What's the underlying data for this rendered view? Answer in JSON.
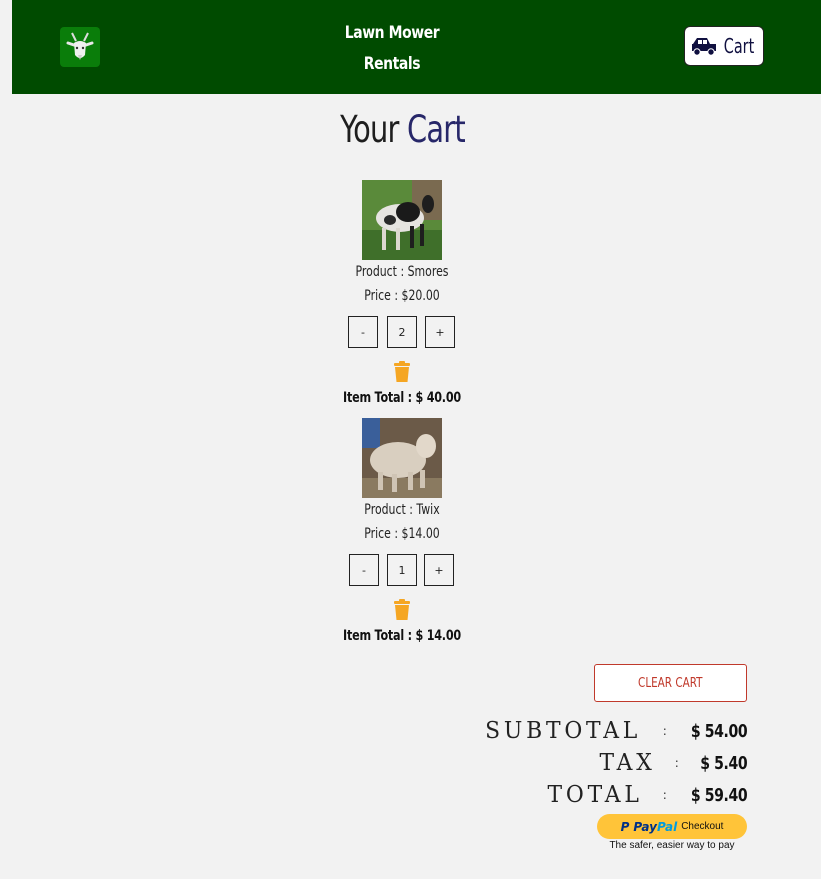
{
  "nav": {
    "brand_line1": "Lawn Mower",
    "brand_line2": "Rentals",
    "logo_icon": "goat-icon",
    "cart_label": "Cart",
    "cart_icon": "truck-icon"
  },
  "page": {
    "title_word1": "Your",
    "title_word2": "Cart"
  },
  "items": [
    {
      "product": "Product : Smores",
      "price": "Price : $20.00",
      "minus": "-",
      "qty": "2",
      "plus": "+",
      "item_total": "Item Total : $ 40.00"
    },
    {
      "product": "Product : Twix",
      "price": "Price : $14.00",
      "minus": "-",
      "qty": "1",
      "plus": "+",
      "item_total": "Item Total : $ 14.00"
    }
  ],
  "summary": {
    "clear_label": "CLEAR CART",
    "subtotal_label": "SUBTOTAL",
    "subtotal_value": "$ 54.00",
    "tax_label": "TAX",
    "tax_value": "$ 5.40",
    "total_label": "TOTAL",
    "total_value": "$ 59.40",
    "colon": ":"
  },
  "paypal": {
    "brand_a": "Pay",
    "brand_b": "Pal",
    "checkout": "Checkout",
    "tagline": "The safer, easier way to pay"
  },
  "colors": {
    "nav_bg": "#004b00",
    "accent": "#272769",
    "clear": "#c0392b",
    "paypal_yellow": "#ffc439",
    "trash": "#f5a623"
  }
}
